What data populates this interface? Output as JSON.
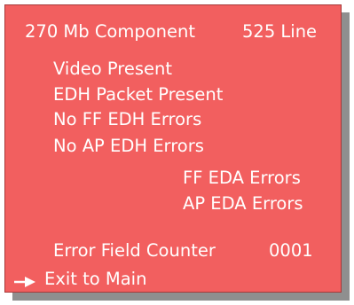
{
  "header": {
    "title": "270 Mb Component",
    "standard": "525 Line"
  },
  "status_items": [
    "Video Present",
    "EDH Packet Present",
    "No FF EDH Errors",
    "No AP EDH Errors"
  ],
  "error_items": [
    "FF EDA Errors",
    "AP EDA Errors"
  ],
  "counter": {
    "label": "Error Field Counter",
    "value": "0001"
  },
  "menu": {
    "exit_label": "Exit to Main",
    "pointer_icon": "arrow-right-icon"
  },
  "colors": {
    "panel": "#f25f5f",
    "text": "#ffffff",
    "shadow": "#8f8f8f"
  }
}
